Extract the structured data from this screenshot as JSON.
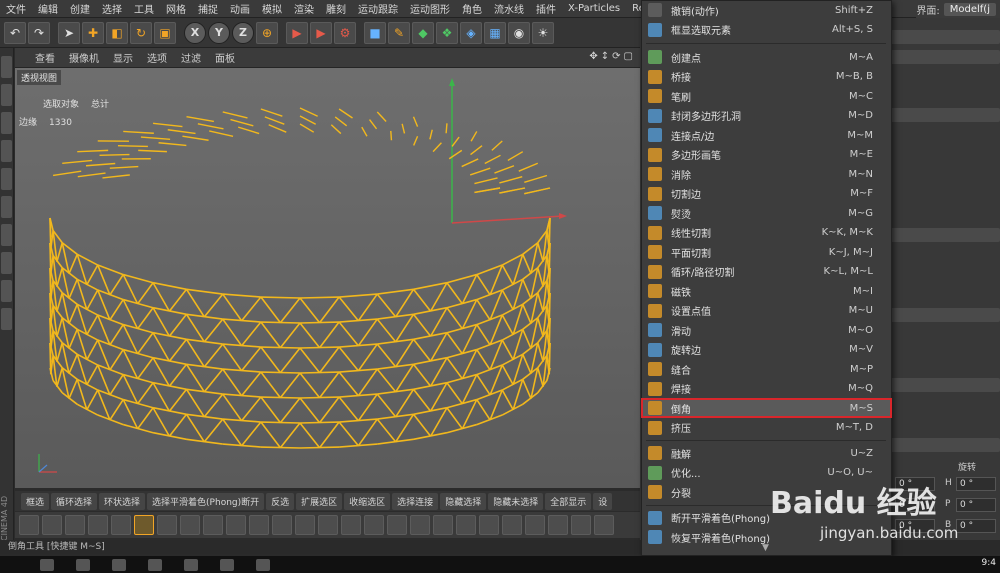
{
  "menubar": {
    "items": [
      "文件",
      "编辑",
      "创建",
      "选择",
      "工具",
      "网格",
      "捕捉",
      "动画",
      "模拟",
      "渲染",
      "雕刻",
      "运动跟踪",
      "运动图形",
      "角色",
      "流水线",
      "插件",
      "X-Particles",
      "RealFlow"
    ],
    "layout_label": "界面:",
    "layout_value": "Modelf(j"
  },
  "viewport": {
    "menu": [
      "查看",
      "摄像机",
      "显示",
      "选项",
      "过滤",
      "面板"
    ],
    "label": "透视视图",
    "stats": {
      "selected_label": "选取对象",
      "total_label": "总计",
      "edges_label": "边缘",
      "edges_value": "1330"
    }
  },
  "modebar": [
    "框选",
    "循环选择",
    "环状选择",
    "选择平滑着色(Phong)断开",
    "反选",
    "扩展选区",
    "收缩选区",
    "选择连接",
    "隐藏选择",
    "隐藏未选择",
    "全部显示",
    "设"
  ],
  "status": "倒角工具 [快捷键 M~S]",
  "brand": "CINEMA 4D",
  "context_menu": {
    "items": [
      {
        "label": "撤销(动作)",
        "shortcut": "Shift+Z",
        "icon": "undo-icon"
      },
      {
        "label": "框显选取元素",
        "shortcut": "Alt+S, S",
        "icon": "frame-icon"
      },
      {
        "label": "创建点",
        "shortcut": "M~A",
        "icon": "create-point-icon"
      },
      {
        "label": "桥接",
        "shortcut": "M~B, B",
        "icon": "bridge-icon"
      },
      {
        "label": "笔刷",
        "shortcut": "M~C",
        "icon": "brush-icon"
      },
      {
        "label": "封闭多边形孔洞",
        "shortcut": "M~D",
        "icon": "close-hole-icon"
      },
      {
        "label": "连接点/边",
        "shortcut": "M~M",
        "icon": "connect-icon"
      },
      {
        "label": "多边形画笔",
        "shortcut": "M~E",
        "icon": "polygon-pen-icon"
      },
      {
        "label": "消除",
        "shortcut": "M~N",
        "icon": "dissolve-icon"
      },
      {
        "label": "切割边",
        "shortcut": "M~F",
        "icon": "edge-cut-icon"
      },
      {
        "label": "熨烫",
        "shortcut": "M~G",
        "icon": "iron-icon"
      },
      {
        "label": "线性切割",
        "shortcut": "K~K, M~K",
        "icon": "line-cut-icon"
      },
      {
        "label": "平面切割",
        "shortcut": "K~J, M~J",
        "icon": "plane-cut-icon"
      },
      {
        "label": "循环/路径切割",
        "shortcut": "K~L, M~L",
        "icon": "loop-cut-icon"
      },
      {
        "label": "磁铁",
        "shortcut": "M~I",
        "icon": "magnet-icon"
      },
      {
        "label": "设置点值",
        "shortcut": "M~U",
        "icon": "set-point-icon"
      },
      {
        "label": "滑动",
        "shortcut": "M~O",
        "icon": "slide-icon"
      },
      {
        "label": "旋转边",
        "shortcut": "M~V",
        "icon": "spin-edge-icon"
      },
      {
        "label": "缝合",
        "shortcut": "M~P",
        "icon": "stitch-icon"
      },
      {
        "label": "焊接",
        "shortcut": "M~Q",
        "icon": "weld-icon"
      },
      {
        "label": "倒角",
        "shortcut": "M~S",
        "icon": "bevel-icon"
      },
      {
        "label": "挤压",
        "shortcut": "M~T, D",
        "icon": "extrude-icon"
      },
      {
        "label": "融解",
        "shortcut": "U~Z",
        "icon": "melt-icon"
      },
      {
        "label": "优化...",
        "shortcut": "U~O, U~",
        "icon": "optimize-icon"
      },
      {
        "label": "分裂",
        "shortcut": "",
        "icon": "split-icon"
      },
      {
        "label": "断开平滑着色(Phong)",
        "shortcut": "",
        "icon": "break-phong-icon"
      },
      {
        "label": "恢复平滑着色(Phong)",
        "shortcut": "",
        "icon": "unbreak-phong-icon"
      }
    ]
  },
  "right_panel": {
    "rotate_label": "旋转",
    "fields": [
      {
        "axis": "H",
        "value": "0 °"
      },
      {
        "axis": "P",
        "value": "0 °"
      },
      {
        "axis": "B",
        "value": "0 °"
      }
    ],
    "left_values": [
      "0 °",
      "0 °",
      "0 °"
    ]
  },
  "taskbar": {
    "clock": "9:4"
  },
  "watermark": {
    "logo": "Baidu 经验",
    "url": "jingyan.baidu.com"
  }
}
